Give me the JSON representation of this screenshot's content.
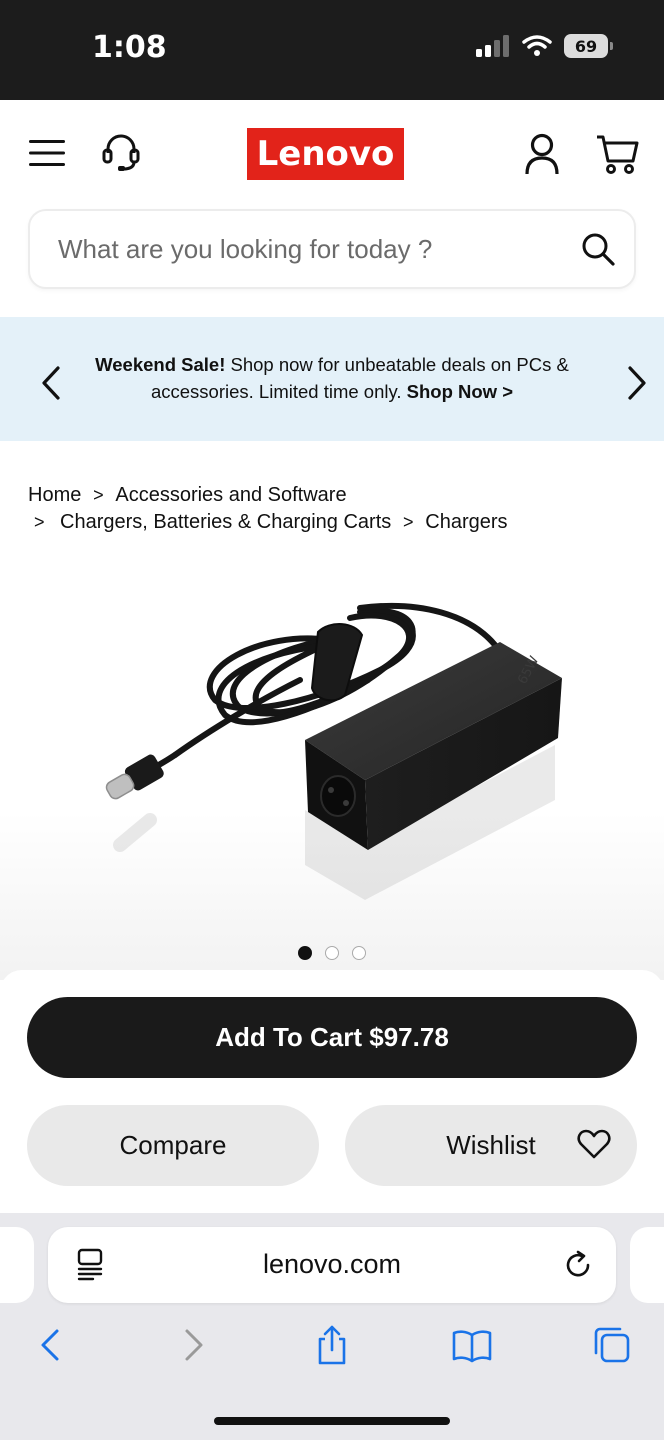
{
  "status_bar": {
    "time": "1:08",
    "battery": "69"
  },
  "header": {
    "logo_text": "Lenovo",
    "icons": [
      "menu-icon",
      "headset-icon",
      "account-icon",
      "cart-icon"
    ]
  },
  "search": {
    "placeholder": "What are you looking for today ?"
  },
  "promo": {
    "bold_lead": "Weekend Sale!",
    "text": " Shop now for unbeatable deals on PCs & accessories. Limited time only. ",
    "link": "Shop Now >"
  },
  "breadcrumb": {
    "items": [
      "Home",
      "Accessories and Software",
      "Chargers, Batteries & Charging Carts",
      "Chargers"
    ],
    "separator": ">"
  },
  "product": {
    "image_label": "65W",
    "carousel": {
      "count": 3,
      "active_index": 0
    }
  },
  "actions": {
    "add_to_cart": "Add To Cart $97.78",
    "compare": "Compare",
    "wishlist": "Wishlist"
  },
  "browser": {
    "url": "lenovo.com"
  },
  "colors": {
    "brand": "#e2231a",
    "promo_bg": "#e4f1f9",
    "cta": "#1a1a1a",
    "link_blue": "#1a73e8"
  }
}
